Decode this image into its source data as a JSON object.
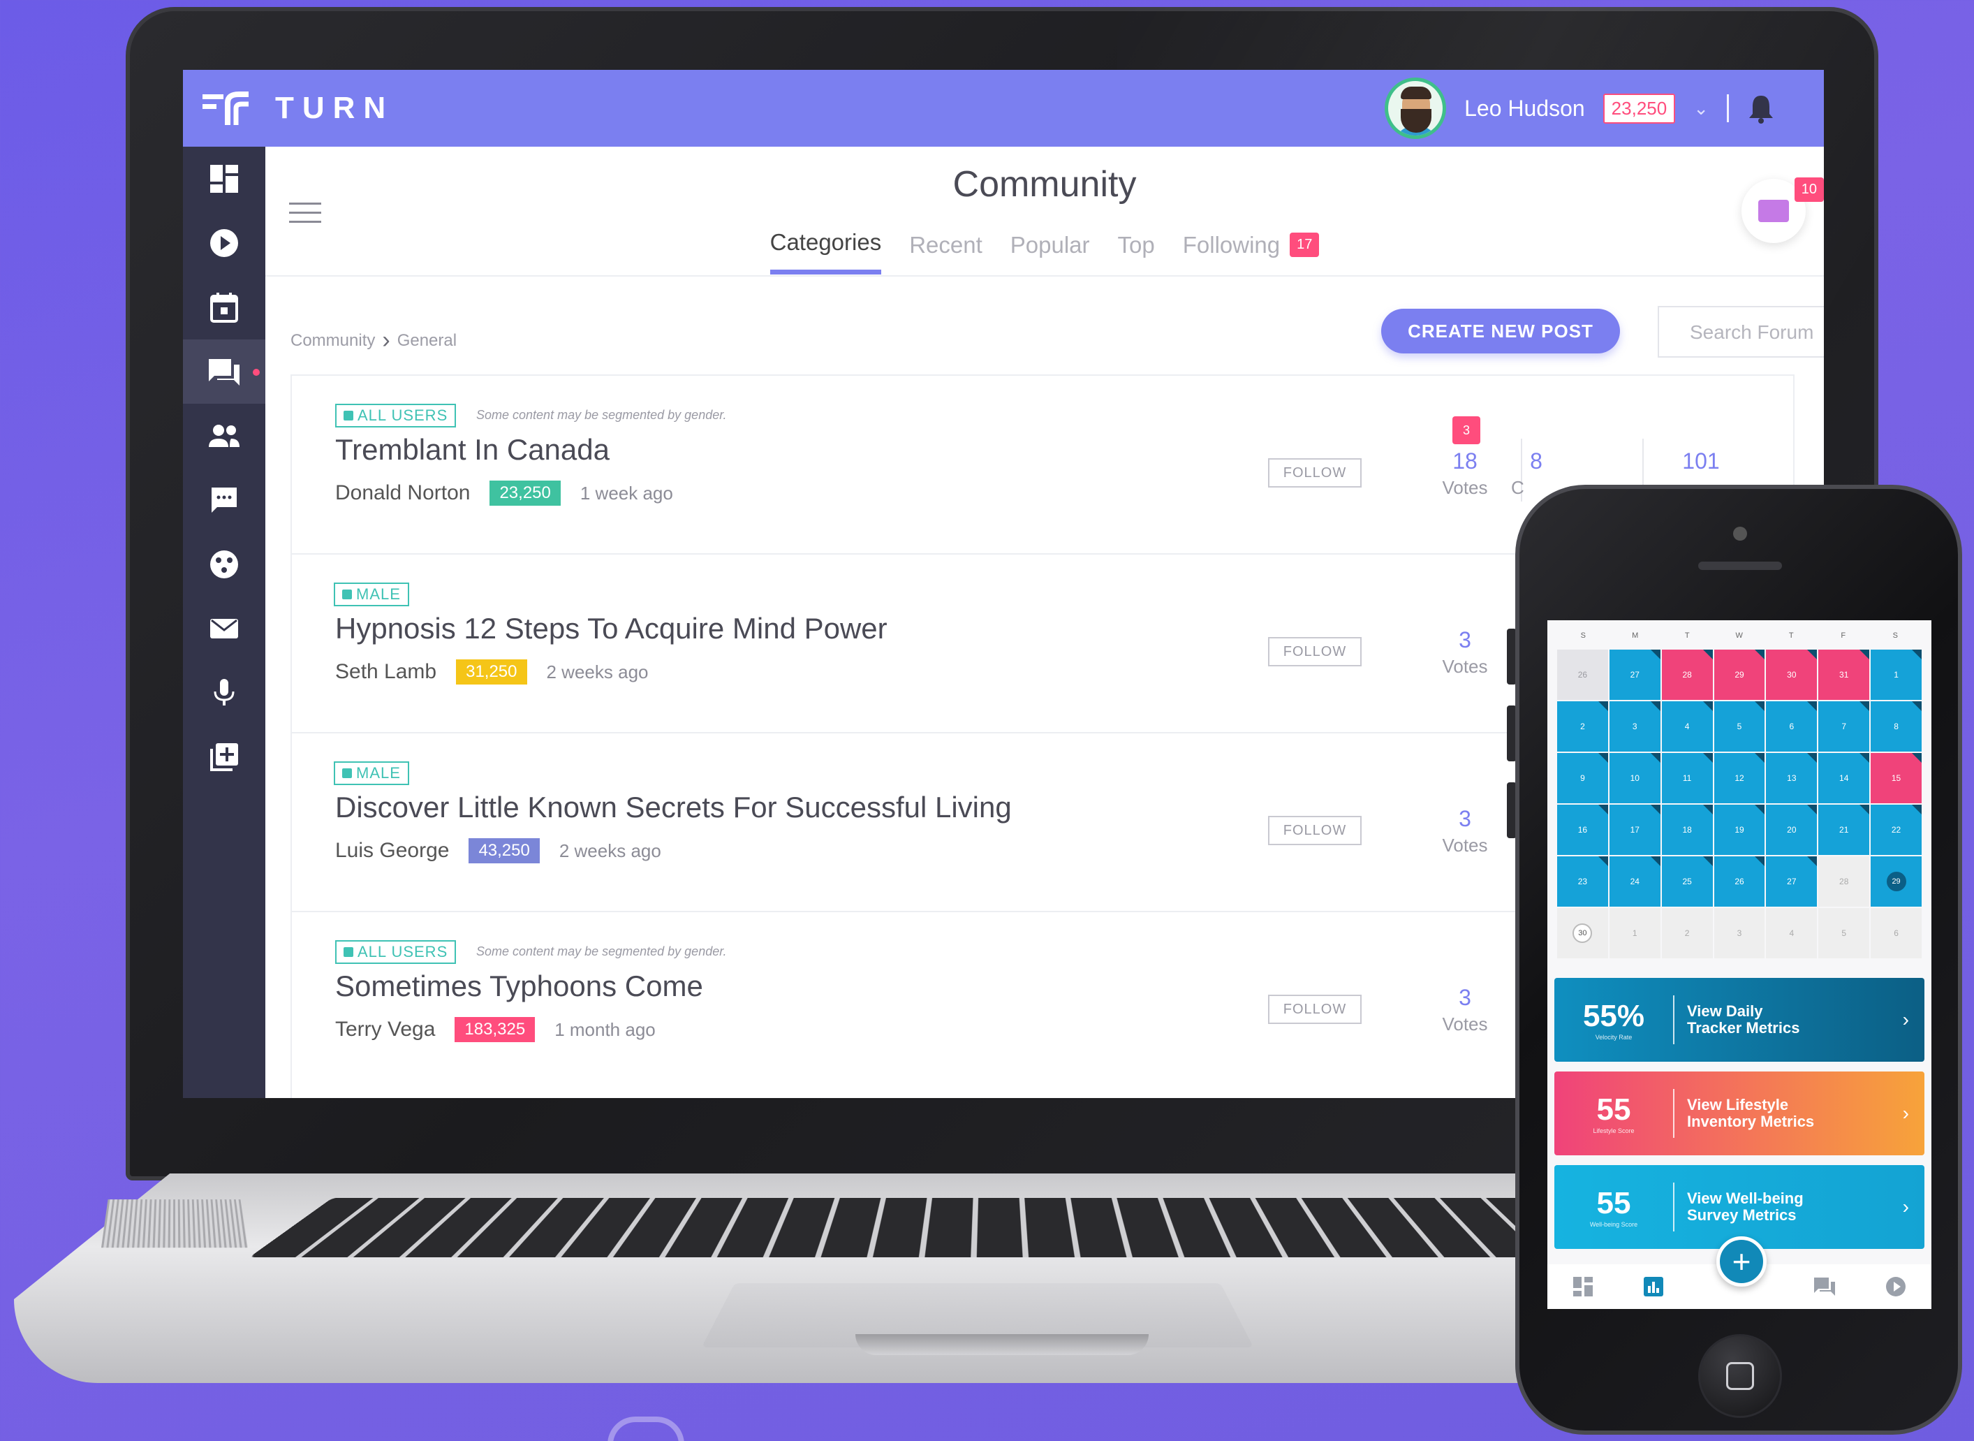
{
  "app": {
    "logo_text": "TURN",
    "user_name": "Leo Hudson",
    "user_points": "23,250"
  },
  "colors": {
    "accent": "#7b7ff0",
    "sidebar": "#33344a",
    "badge": "#ff4d7d",
    "teal": "#3fc2b4"
  },
  "sidebar": {
    "items": [
      {
        "icon": "dashboard-icon"
      },
      {
        "icon": "play-icon"
      },
      {
        "icon": "calendar-icon"
      },
      {
        "icon": "forum-icon",
        "active": true
      },
      {
        "icon": "people-icon"
      },
      {
        "icon": "chat-icon"
      },
      {
        "icon": "palette-icon"
      },
      {
        "icon": "mail-icon"
      },
      {
        "icon": "microphone-icon"
      },
      {
        "icon": "add-box-icon"
      }
    ]
  },
  "header": {
    "title": "Community",
    "tabs": [
      {
        "label": "Categories"
      },
      {
        "label": "Recent"
      },
      {
        "label": "Popular"
      },
      {
        "label": "Top"
      },
      {
        "label": "Following",
        "badge": "17"
      }
    ],
    "mail_badge": "10"
  },
  "toolbar": {
    "breadcrumb": [
      "Community",
      "General"
    ],
    "create_label": "CREATE NEW POST",
    "search_placeholder": "Search Forum"
  },
  "posts": [
    {
      "tag": "ALL USERS",
      "note": "Some content may be segmented by gender.",
      "title": "Tremblant In Canada",
      "author": "Donald Norton",
      "points": "23,250",
      "points_color": "#3fc2a0",
      "ago": "1 week ago",
      "follow": "FOLLOW",
      "votes": "18",
      "votes_label": "Votes",
      "comments": "8",
      "comments_label": "C",
      "comments_badge": "3",
      "views": "101"
    },
    {
      "tag": "MALE",
      "title": "Hypnosis 12 Steps To Acquire Mind Power",
      "author": "Seth Lamb",
      "points": "31,250",
      "points_color": "#f5c518",
      "ago": "2 weeks ago",
      "follow": "FOLLOW",
      "votes": "3",
      "votes_label": "Votes"
    },
    {
      "tag": "MALE",
      "title": "Discover Little Known Secrets For Successful Living",
      "author": "Luis George",
      "points": "43,250",
      "points_color": "#7b86d8",
      "ago": "2 weeks ago",
      "follow": "FOLLOW",
      "votes": "3",
      "votes_label": "Votes"
    },
    {
      "tag": "ALL USERS",
      "note": "Some content may be segmented by gender.",
      "title": "Sometimes Typhoons Come",
      "author": "Terry Vega",
      "points": "183,325",
      "points_color": "#ff4d7d",
      "ago": "1 month ago",
      "follow": "FOLLOW",
      "votes": "3",
      "votes_label": "Votes"
    }
  ],
  "phone": {
    "weekdays": [
      "S",
      "M",
      "T",
      "W",
      "T",
      "F",
      "S"
    ],
    "calendar": [
      {
        "d": "26",
        "s": "grey"
      },
      {
        "d": "27",
        "s": "blue"
      },
      {
        "d": "28",
        "s": "pink"
      },
      {
        "d": "29",
        "s": "pink"
      },
      {
        "d": "30",
        "s": "pink"
      },
      {
        "d": "31",
        "s": "pink"
      },
      {
        "d": "1",
        "s": "blue"
      },
      {
        "d": "2",
        "s": "blue"
      },
      {
        "d": "3",
        "s": "blue"
      },
      {
        "d": "4",
        "s": "blue"
      },
      {
        "d": "5",
        "s": "blue"
      },
      {
        "d": "6",
        "s": "blue"
      },
      {
        "d": "7",
        "s": "blue"
      },
      {
        "d": "8",
        "s": "blue"
      },
      {
        "d": "9",
        "s": "blue"
      },
      {
        "d": "10",
        "s": "blue"
      },
      {
        "d": "11",
        "s": "blue"
      },
      {
        "d": "12",
        "s": "blue"
      },
      {
        "d": "13",
        "s": "blue"
      },
      {
        "d": "14",
        "s": "blue"
      },
      {
        "d": "15",
        "s": "pink"
      },
      {
        "d": "16",
        "s": "blue"
      },
      {
        "d": "17",
        "s": "blue"
      },
      {
        "d": "18",
        "s": "blue"
      },
      {
        "d": "19",
        "s": "blue"
      },
      {
        "d": "20",
        "s": "blue"
      },
      {
        "d": "21",
        "s": "blue"
      },
      {
        "d": "22",
        "s": "blue"
      },
      {
        "d": "23",
        "s": "blue"
      },
      {
        "d": "24",
        "s": "blue"
      },
      {
        "d": "25",
        "s": "blue"
      },
      {
        "d": "26",
        "s": "blue"
      },
      {
        "d": "27",
        "s": "blue"
      },
      {
        "d": "28",
        "s": "light"
      },
      {
        "d": "29",
        "s": "today"
      },
      {
        "d": "30",
        "s": "ring"
      },
      {
        "d": "1",
        "s": "light"
      },
      {
        "d": "2",
        "s": "light"
      },
      {
        "d": "3",
        "s": "light"
      },
      {
        "d": "4",
        "s": "light"
      },
      {
        "d": "5",
        "s": "light"
      },
      {
        "d": "6",
        "s": "light"
      }
    ],
    "metrics": [
      {
        "value": "55%",
        "sub": "Velocity Rate",
        "label1": "View Daily",
        "label2": "Tracker Metrics",
        "bg": "linear-gradient(90deg,#0f8fc0,#0c5f85)"
      },
      {
        "value": "55",
        "sub": "Lifestyle Score",
        "label1": "View Lifestyle",
        "label2": "Inventory Metrics",
        "bg": "linear-gradient(90deg,#f0437a,#f7a33a)"
      },
      {
        "value": "55",
        "sub": "Well-being Score",
        "label1": "View Well-being",
        "label2": "Survey Metrics",
        "bg": "linear-gradient(90deg,#16b3e0,#14a3d3)"
      }
    ],
    "fab": "+"
  }
}
